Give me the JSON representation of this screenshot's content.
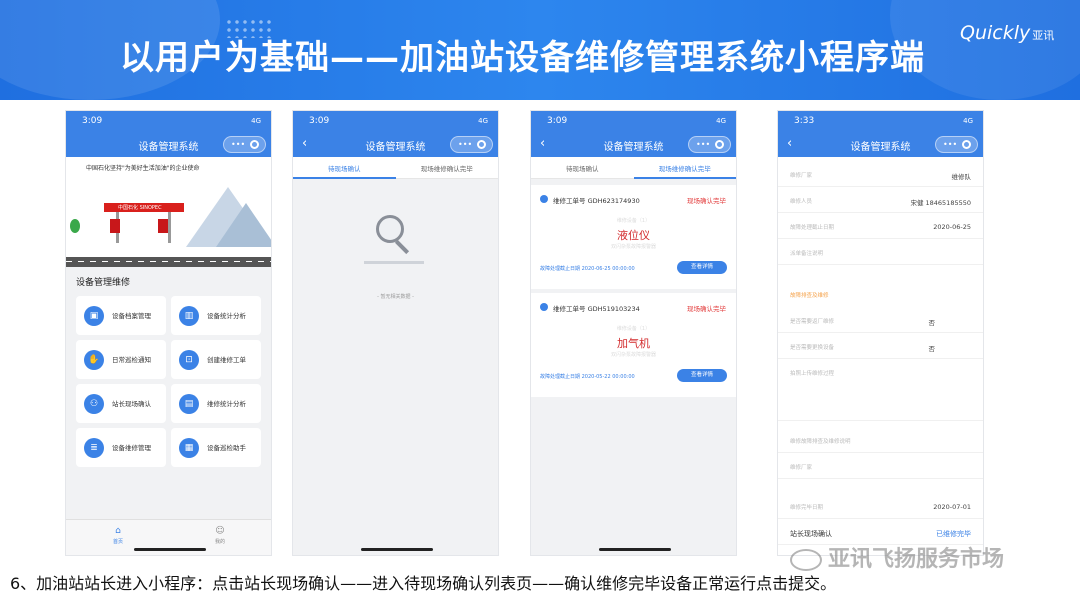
{
  "banner": {
    "title": "以用户为基础——加油站设备维修管理系统小程序端",
    "logo_text": "Quickly",
    "logo_cn": "亚讯"
  },
  "phones": [
    {
      "time": "3:09",
      "signal": "4G",
      "nav_title": "设备管理系统",
      "hero": {
        "slogan": "中国石化坚持\"为美好生活加油\"的企业使命",
        "station_sign": "中国石化 SINOPEC"
      },
      "section_title": "设备管理维修",
      "tiles": [
        {
          "label": "设备档案管理",
          "icon": "folder-icon"
        },
        {
          "label": "设备统计分析",
          "icon": "bar-chart-icon"
        },
        {
          "label": "日常巡检通知",
          "icon": "hand-icon"
        },
        {
          "label": "创建维修工单",
          "icon": "inbox-icon"
        },
        {
          "label": "站长现场确认",
          "icon": "people-icon"
        },
        {
          "label": "维修统计分析",
          "icon": "chart-icon"
        },
        {
          "label": "设备维修管理",
          "icon": "document-icon"
        },
        {
          "label": "设备巡检助手",
          "icon": "clipboard-icon"
        }
      ],
      "tabbar": {
        "home": "首页",
        "mine": "我的"
      }
    },
    {
      "time": "3:09",
      "signal": "4G",
      "nav_title": "设备管理系统",
      "tabs": [
        "待现场确认",
        "现场维修确认完毕"
      ],
      "empty_text": "- 暂无相关数据 -"
    },
    {
      "time": "3:09",
      "signal": "4G",
      "nav_title": "设备管理系统",
      "tabs": [
        "待现场确认",
        "现场维修确认完毕"
      ],
      "cards": [
        {
          "order_no": "维修工单号 GDH623174930",
          "status": "现场确认完毕",
          "sub1": "维修设备（1）",
          "device": "液位仪",
          "sub2": "双闪杂泵故障报警器",
          "deadline": "故障处理截止日期 2020-06-25 00:00:00",
          "button": "查看详情"
        },
        {
          "order_no": "维修工单号 GDH519103234",
          "status": "现场确认完毕",
          "sub1": "维修设备（1）",
          "device": "加气机",
          "sub2": "双闪杂泵故障报警器",
          "deadline": "故障处理截止日期 2020-05-22 00:00:00",
          "button": "查看详情"
        }
      ]
    },
    {
      "time": "3:33",
      "signal": "4G",
      "nav_title": "设备管理系统",
      "rows": [
        {
          "k": "维修厂家",
          "v": "维修队"
        },
        {
          "k": "维修人员",
          "v": "宋健 18465185550"
        },
        {
          "k": "故障处理截止日期",
          "v": "2020-06-25"
        },
        {
          "k": "派单备注说明",
          "v": ""
        }
      ],
      "section_label": "故障排查及维修",
      "rows2": [
        {
          "k": "是否需要返厂维修",
          "v": "否"
        },
        {
          "k": "是否需要更换设备",
          "v": "否"
        },
        {
          "k": "拍照上传维修过程",
          "v": ""
        }
      ],
      "rows3": [
        {
          "k": "维修故障排查及维修说明",
          "v": ""
        },
        {
          "k": "维修厂家",
          "v": ""
        },
        {
          "k": "维修完毕日期",
          "v": "2020-07-01"
        }
      ],
      "confirm": {
        "k": "站长现场确认",
        "v": "已维修完毕"
      }
    }
  ],
  "caption": "6、加油站站长进入小程序：点击站长现场确认——进入待现场确认列表页——确认维修完毕设备正常运行点击提交。",
  "watermark": "亚讯飞扬服务市场"
}
